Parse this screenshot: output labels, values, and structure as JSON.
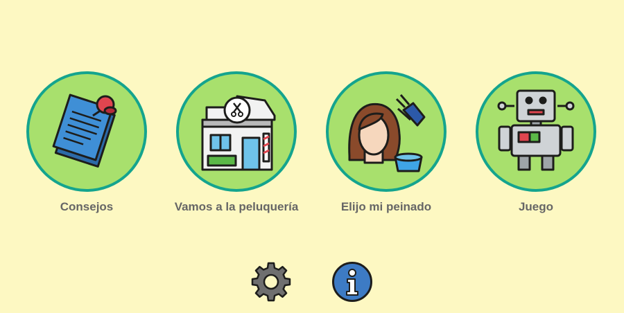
{
  "menu": {
    "items": [
      {
        "label": "Consejos",
        "icon": "notes-pin-icon"
      },
      {
        "label": "Vamos a la peluquería",
        "icon": "barbershop-icon"
      },
      {
        "label": "Elijo mi peinado",
        "icon": "hair-dye-icon"
      },
      {
        "label": "Juego",
        "icon": "robot-icon"
      }
    ]
  },
  "footer": {
    "icons": [
      "gear-icon",
      "info-icon"
    ]
  },
  "colors": {
    "background": "#fdf8c2",
    "circle_fill": "#a8e06d",
    "circle_border": "#14a48e",
    "label_text": "#666666",
    "info_blue": "#3d7bc4"
  }
}
